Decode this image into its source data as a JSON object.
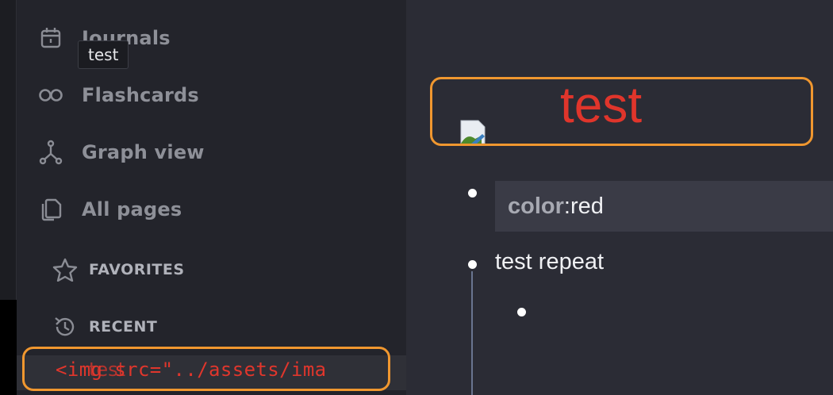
{
  "sidebar": {
    "nav": [
      {
        "label": "Journals",
        "icon": "calendar-icon"
      },
      {
        "label": "Flashcards",
        "icon": "infinity-icon"
      },
      {
        "label": "Graph view",
        "icon": "graph-icon"
      },
      {
        "label": "All pages",
        "icon": "pages-icon"
      }
    ],
    "favorites_label": "FAVORITES",
    "recent_label": "RECENT",
    "recent_item_text": "<img src=\"../assets/ima",
    "recent_item_overlay": "test",
    "tooltip": "test"
  },
  "page": {
    "title": "test",
    "blocks": [
      {
        "prop_key": "color",
        "prop_sep": ": ",
        "prop_value": "red"
      },
      {
        "text": "test repeat"
      },
      {
        "text": ""
      }
    ]
  },
  "colors": {
    "highlight": "#f0972f",
    "title_red": "#e0352b",
    "sidebar_bg": "#23242b",
    "main_bg": "#2b2c35"
  }
}
